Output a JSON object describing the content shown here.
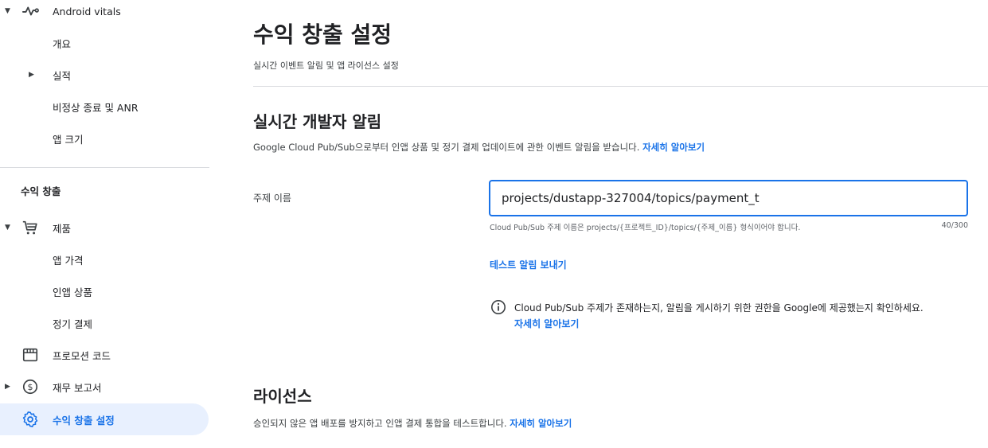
{
  "sidebar": {
    "android_vitals": {
      "label": "Android vitals",
      "icon": "vitals-pulse-icon",
      "items": [
        {
          "label": "개요"
        },
        {
          "label": "실적"
        },
        {
          "label": "비정상 종료 및 ANR"
        },
        {
          "label": "앱 크기"
        }
      ]
    },
    "monetize_section_title": "수익 창출",
    "products": {
      "label": "제품",
      "icon": "cart-icon",
      "items": [
        {
          "label": "앱 가격"
        },
        {
          "label": "인앱 상품"
        },
        {
          "label": "정기 결제"
        }
      ]
    },
    "promo_codes": {
      "label": "프로모션 코드",
      "icon": "store-icon"
    },
    "financial_reports": {
      "label": "재무 보고서",
      "icon": "dollar-circle-icon"
    },
    "monetization_setup": {
      "label": "수익 창출 설정",
      "icon": "gear-icon"
    }
  },
  "main": {
    "title": "수익 창출 설정",
    "subtitle": "실시간 이벤트 알림 및 앱 라이선스 설정",
    "rtdn": {
      "title": "실시간 개발자 알림",
      "description": "Google Cloud Pub/Sub으로부터 인앱 상품 및 정기 결제 업데이트에 관한 이벤트 알림을 받습니다.",
      "learn_more": "자세히 알아보기",
      "field_label": "주제 이름",
      "input_value": "projects/dustapp-327004/topics/payment_t",
      "helper": "Cloud Pub/Sub 주제 이름은 projects/{프로젝트_ID}/topics/{주제_이름} 형식이어야 합니다.",
      "counter": "40/300",
      "test_link": "테스트 알림 보내기",
      "info_text": "Cloud Pub/Sub 주제가 존재하는지, 알림을 게시하기 위한 권한을 Google에 제공했는지 확인하세요.",
      "info_link": "자세히 알아보기"
    },
    "licensing": {
      "title": "라이선스",
      "description": "승인되지 않은 앱 배포를 방지하고 인앱 결제 통합을 테스트합니다.",
      "learn_more": "자세히 알아보기"
    }
  },
  "colors": {
    "accent": "#1a73e8",
    "active_bg": "#e8f0fe",
    "divider": "#dadce0"
  }
}
